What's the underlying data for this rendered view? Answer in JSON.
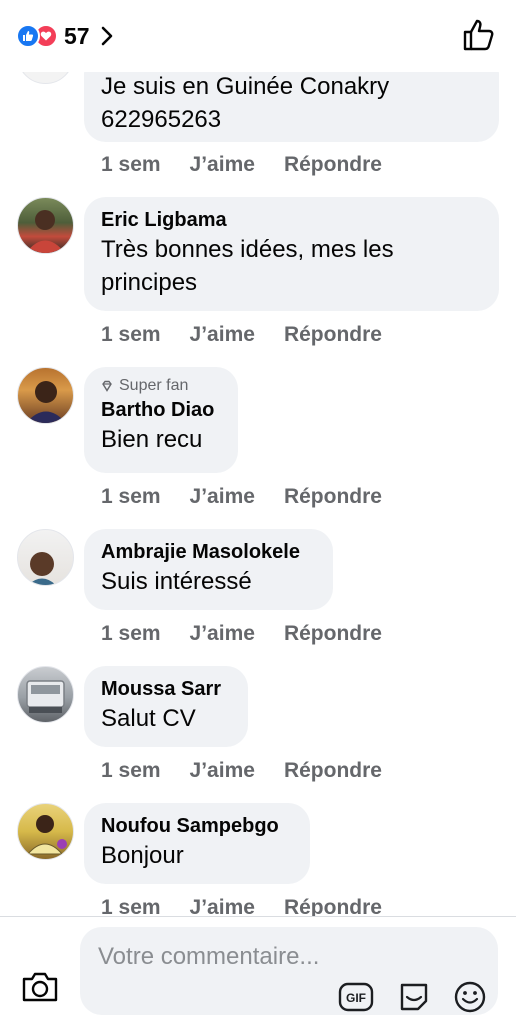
{
  "header": {
    "reaction_count": "57",
    "reaction_icons": [
      "like-icon",
      "love-icon"
    ]
  },
  "comments": [
    {
      "author": "",
      "text_lines": [
        "Je suis en Guinée Conakry",
        "622965263"
      ],
      "time": "1 sem",
      "like_label": "J’aime",
      "reply_label": "Répondre"
    },
    {
      "author": "Eric Ligbama",
      "text_lines": [
        "Très bonnes idées, mes les",
        "principes"
      ],
      "time": "1 sem",
      "like_label": "J’aime",
      "reply_label": "Répondre"
    },
    {
      "badge": "Super fan",
      "author": "Bartho Diao",
      "text_lines": [
        "Bien recu"
      ],
      "time": "1 sem",
      "like_label": "J’aime",
      "reply_label": "Répondre"
    },
    {
      "author": "Ambrajie Masolokele",
      "text_lines": [
        "Suis intéressé"
      ],
      "time": "1 sem",
      "like_label": "J’aime",
      "reply_label": "Répondre"
    },
    {
      "author": "Moussa Sarr",
      "text_lines": [
        "Salut CV"
      ],
      "time": "1 sem",
      "like_label": "J’aime",
      "reply_label": "Répondre"
    },
    {
      "author": "Noufou Sampebgo",
      "text_lines": [
        "Bonjour"
      ],
      "time": "1 sem",
      "like_label": "J’aime",
      "reply_label": "Répondre"
    }
  ],
  "composer": {
    "placeholder": "Votre commentaire...",
    "gif_label": "GIF"
  },
  "colors": {
    "like_blue": "#1877f2",
    "love_red": "#f33e58",
    "bubble_bg": "#f0f2f5",
    "meta_gray": "#65676b"
  }
}
